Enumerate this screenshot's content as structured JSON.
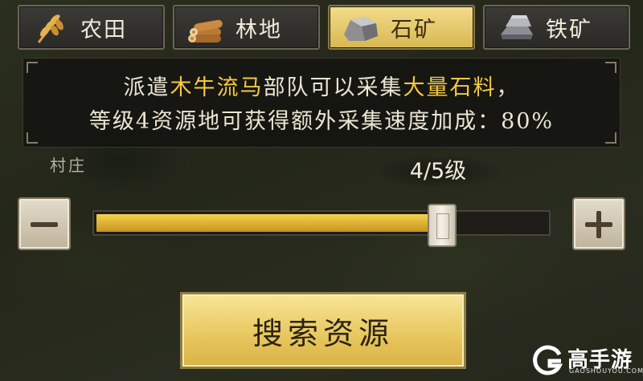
{
  "tabs": [
    {
      "label": "农田",
      "icon": "wheat-icon",
      "active": false
    },
    {
      "label": "林地",
      "icon": "logs-icon",
      "active": false
    },
    {
      "label": "石矿",
      "icon": "stone-icon",
      "active": true
    },
    {
      "label": "铁矿",
      "icon": "iron-ingot-icon",
      "active": false
    }
  ],
  "info": {
    "l1_a": "派遣",
    "l1_b": "木牛流马",
    "l1_c": "部队可以采集",
    "l1_d": "大量石料",
    "l1_e": "，",
    "line2": "等级4资源地可获得额外采集速度加成：80%"
  },
  "village_label": "村庄",
  "level": {
    "label": "4/5级",
    "current": 4,
    "max": 5,
    "fill_fraction": 0.76
  },
  "buttons": {
    "minus": "minus-icon",
    "plus": "plus-icon",
    "search_label": "搜索资源"
  },
  "watermark": {
    "text": "高手游",
    "sub": "GAOSHOUYOU.COM"
  },
  "colors": {
    "highlight": "#f4c843",
    "active_tab": "#e9c866",
    "fill": "#e2b435"
  }
}
